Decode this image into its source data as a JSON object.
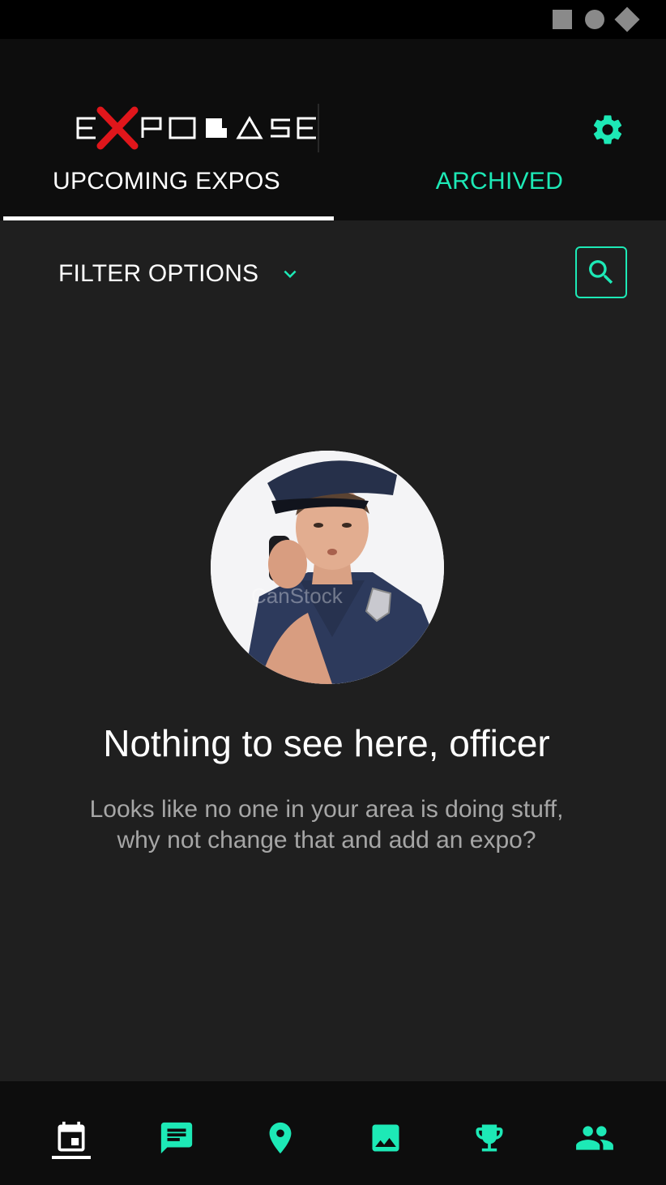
{
  "app": {
    "logo_text": "EXPOBASE",
    "accent_color": "#1de9b6",
    "logo_x_color": "#e0161b"
  },
  "tabs": [
    {
      "label": "UPCOMING EXPOS",
      "active": true
    },
    {
      "label": "ARCHIVED",
      "active": false
    }
  ],
  "filter": {
    "label": "FILTER OPTIONS",
    "icon": "chevron-down-icon"
  },
  "search": {
    "icon": "search-icon"
  },
  "empty_state": {
    "image": "police-officer-photo",
    "image_watermark": "CanStock",
    "title": "Nothing to see here, officer",
    "subtitle": "Looks like no one in your area is doing stuff, why not change that and add an expo?"
  },
  "bottom_nav": [
    {
      "icon": "calendar-icon",
      "active": true
    },
    {
      "icon": "chat-icon",
      "active": false
    },
    {
      "icon": "location-pin-icon",
      "active": false
    },
    {
      "icon": "image-icon",
      "active": false
    },
    {
      "icon": "trophy-icon",
      "active": false
    },
    {
      "icon": "people-icon",
      "active": false
    }
  ],
  "status_bar_icons": [
    "square-icon",
    "circle-icon",
    "diamond-icon"
  ]
}
